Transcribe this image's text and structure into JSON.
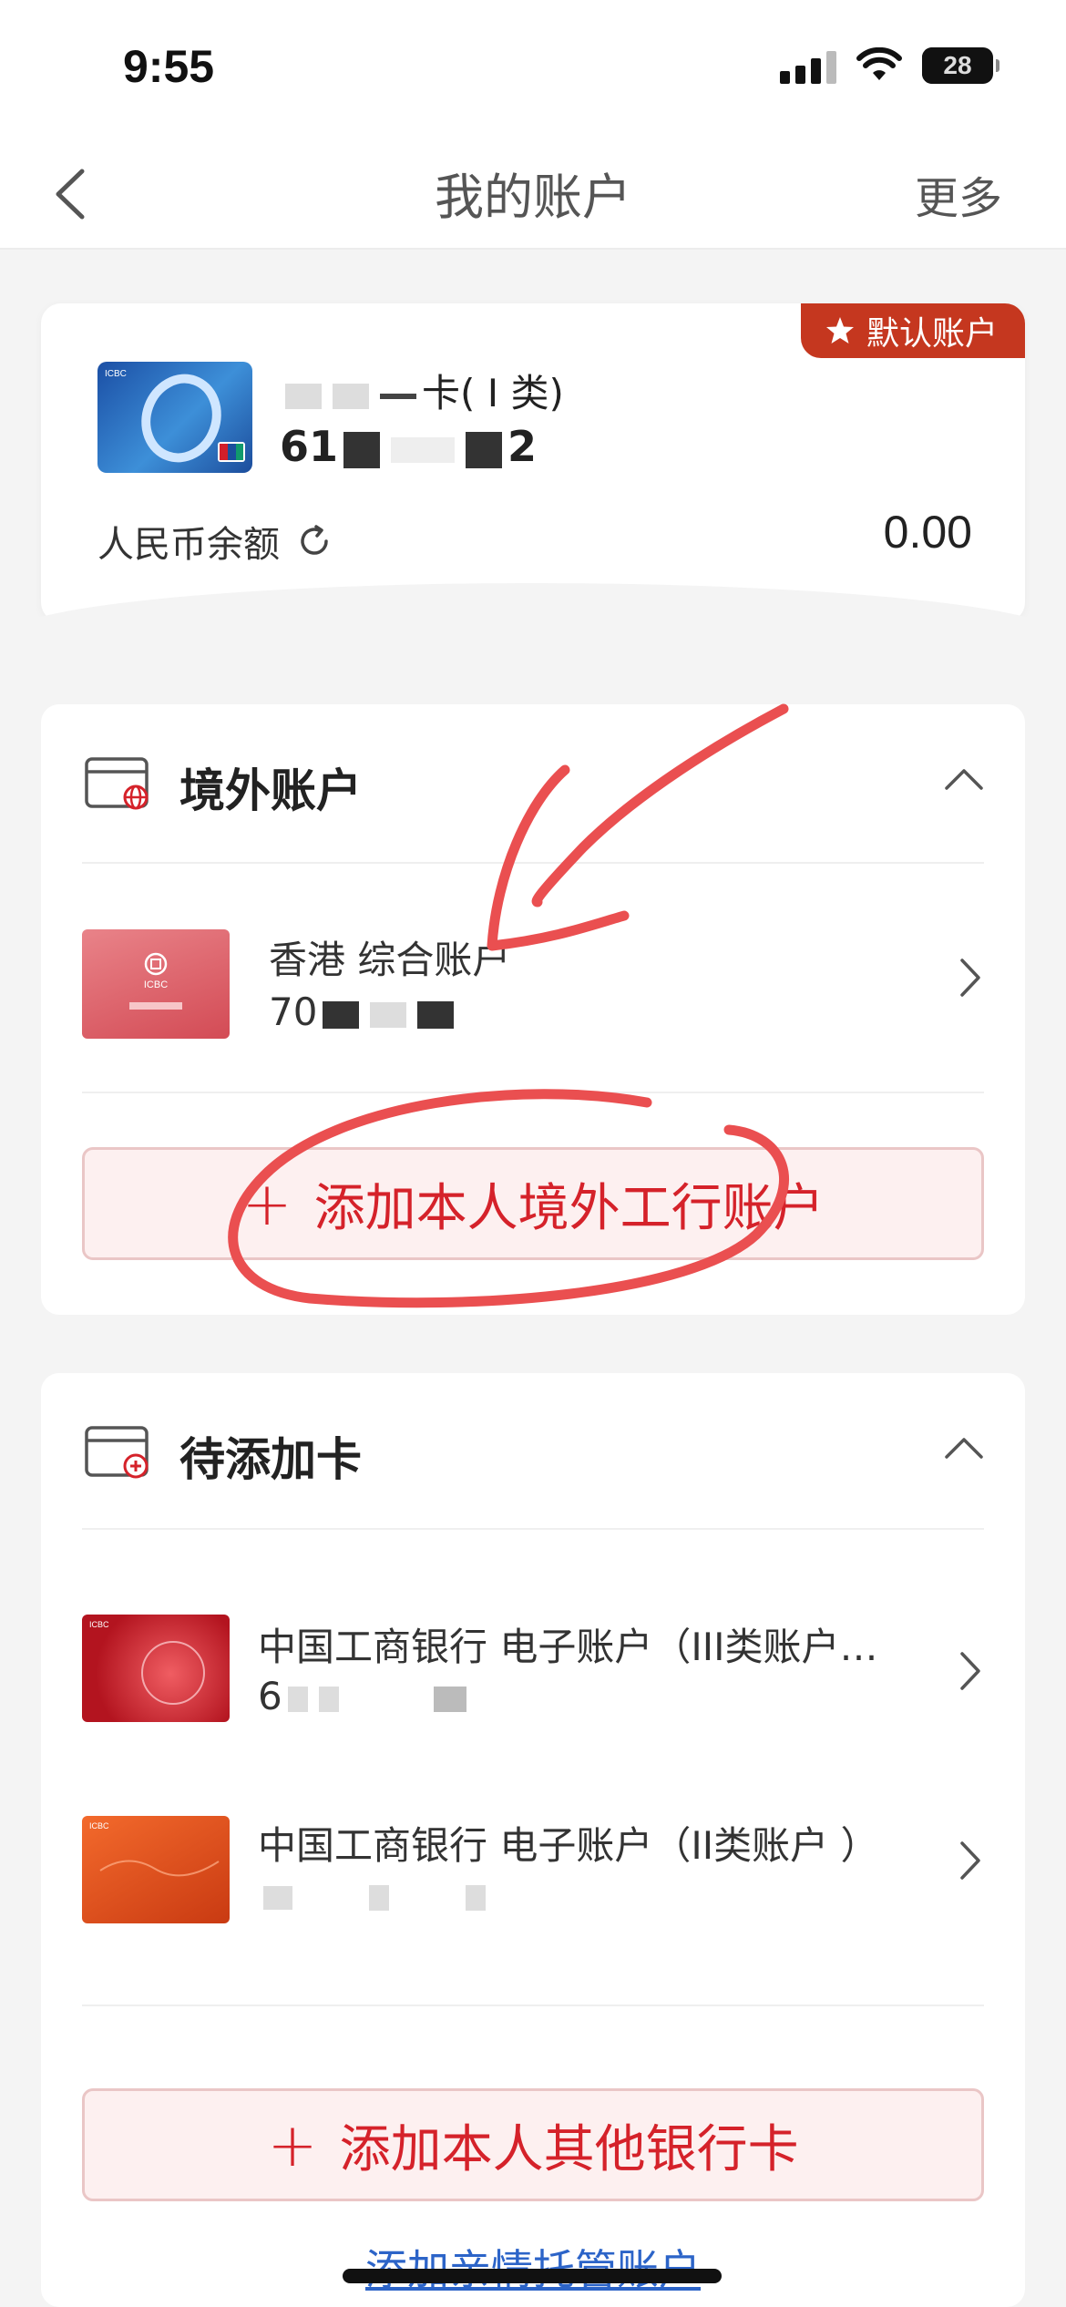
{
  "status_bar": {
    "time": "9:55",
    "battery": "28"
  },
  "nav": {
    "title": "我的账户",
    "more": "更多"
  },
  "default_account": {
    "badge": "默认账户",
    "card_title_suffix": "卡( Ⅰ 类)",
    "card_number_prefix": "61",
    "card_number_suffix": "2",
    "balance_label": "人民币余额",
    "balance": "0.00"
  },
  "overseas": {
    "title": "境外账户",
    "account": {
      "name": "香港 综合账户",
      "number_prefix": "70"
    },
    "add_label": "添加本人境外工行账户"
  },
  "pending": {
    "title": "待添加卡",
    "cards": [
      {
        "name": "中国工商银行 电子账户（III类账户…",
        "number_prefix": "6"
      },
      {
        "name": "中国工商银行 电子账户（II类账户 ）",
        "number_prefix": ""
      }
    ],
    "add_label": "添加本人其他银行卡"
  },
  "footer_link": "添加亲情托管账户",
  "colors": {
    "brand_red": "#c5371f",
    "button_text": "#d5222a",
    "link": "#2c64c8"
  }
}
